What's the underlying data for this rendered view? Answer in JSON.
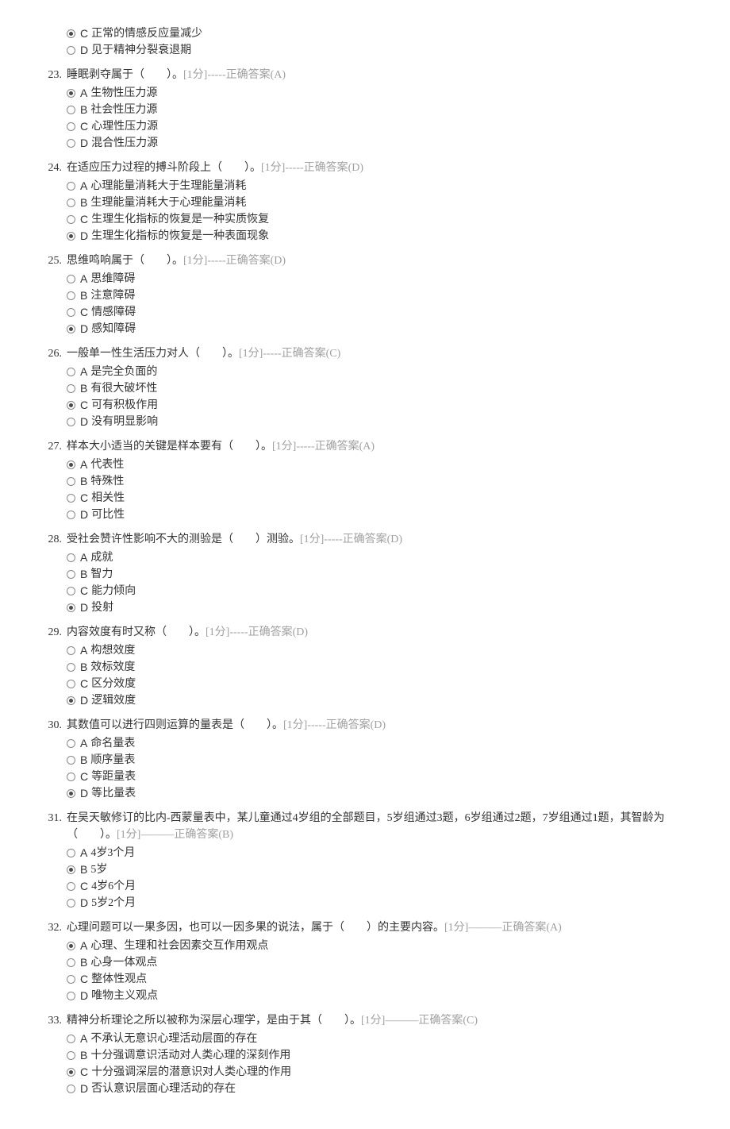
{
  "score_label": "[1分]",
  "answer_dash5_prefix": "-----正确答案",
  "answer_dash3_prefix": "———正确答案",
  "partial_options": [
    {
      "letter": "C",
      "text": " 正常的情感反应量减少",
      "selected": true
    },
    {
      "letter": "D",
      "text": " 见于精神分裂衰退期",
      "selected": false
    }
  ],
  "questions": [
    {
      "num": "23.",
      "text": "睡眠剥夺属于（　　）。",
      "dash": 5,
      "answer_letter": "(A)",
      "options": [
        {
          "letter": "A",
          "text": " 生物性压力源",
          "selected": true
        },
        {
          "letter": "B",
          "text": " 社会性压力源",
          "selected": false
        },
        {
          "letter": "C",
          "text": " 心理性压力源",
          "selected": false
        },
        {
          "letter": "D",
          "text": " 混合性压力源",
          "selected": false
        }
      ]
    },
    {
      "num": "24.",
      "text": "在适应压力过程的搏斗阶段上（　　）。",
      "dash": 5,
      "answer_letter": "(D)",
      "options": [
        {
          "letter": "A",
          "text": " 心理能量消耗大于生理能量消耗",
          "selected": false
        },
        {
          "letter": "B",
          "text": " 生理能量消耗大于心理能量消耗",
          "selected": false
        },
        {
          "letter": "C",
          "text": " 生理生化指标的恢复是一种实质恢复",
          "selected": false
        },
        {
          "letter": "D",
          "text": " 生理生化指标的恢复是一种表面现象",
          "selected": true
        }
      ]
    },
    {
      "num": "25.",
      "text": "思维鸣响属于（　　）。",
      "dash": 5,
      "answer_letter": "(D)",
      "options": [
        {
          "letter": "A",
          "text": " 思维障碍",
          "selected": false
        },
        {
          "letter": "B",
          "text": " 注意障碍",
          "selected": false
        },
        {
          "letter": "C",
          "text": " 情感障碍",
          "selected": false
        },
        {
          "letter": "D",
          "text": " 感知障碍",
          "selected": true
        }
      ]
    },
    {
      "num": "26.",
      "text": "一般单一性生活压力对人（　　）。",
      "dash": 5,
      "answer_letter": "(C)",
      "options": [
        {
          "letter": "A",
          "text": " 是完全负面的",
          "selected": false
        },
        {
          "letter": "B",
          "text": " 有很大破坏性",
          "selected": false
        },
        {
          "letter": "C",
          "text": " 可有积极作用",
          "selected": true
        },
        {
          "letter": "D",
          "text": " 没有明显影响",
          "selected": false
        }
      ]
    },
    {
      "num": "27.",
      "text": "样本大小适当的关键是样本要有（　　）。",
      "dash": 5,
      "answer_letter": "(A)",
      "options": [
        {
          "letter": "A",
          "text": " 代表性",
          "selected": true
        },
        {
          "letter": "B",
          "text": " 特殊性",
          "selected": false
        },
        {
          "letter": "C",
          "text": " 相关性",
          "selected": false
        },
        {
          "letter": "D",
          "text": " 可比性",
          "selected": false
        }
      ]
    },
    {
      "num": "28.",
      "text": "受社会赞许性影响不大的测验是（　　）测验。",
      "dash": 5,
      "answer_letter": "(D)",
      "options": [
        {
          "letter": "A",
          "text": " 成就",
          "selected": false
        },
        {
          "letter": "B",
          "text": " 智力",
          "selected": false
        },
        {
          "letter": "C",
          "text": " 能力倾向",
          "selected": false
        },
        {
          "letter": "D",
          "text": " 投射",
          "selected": true
        }
      ]
    },
    {
      "num": "29.",
      "text": "内容效度有时又称（　　）。",
      "dash": 5,
      "answer_letter": "(D)",
      "options": [
        {
          "letter": "A",
          "text": " 构想效度",
          "selected": false
        },
        {
          "letter": "B",
          "text": " 效标效度",
          "selected": false
        },
        {
          "letter": "C",
          "text": " 区分效度",
          "selected": false
        },
        {
          "letter": "D",
          "text": " 逻辑效度",
          "selected": true
        }
      ]
    },
    {
      "num": "30.",
      "text": "其数值可以进行四则运算的量表是（　　）。",
      "dash": 5,
      "answer_letter": "(D)",
      "options": [
        {
          "letter": "A",
          "text": " 命名量表",
          "selected": false
        },
        {
          "letter": "B",
          "text": " 顺序量表",
          "selected": false
        },
        {
          "letter": "C",
          "text": " 等距量表",
          "selected": false
        },
        {
          "letter": "D",
          "text": " 等比量表",
          "selected": true
        }
      ]
    },
    {
      "num": "31.",
      "text": "在吴天敏修订的比内-西蒙量表中，某儿童通过4岁组的全部题目，5岁组通过3题，6岁组通过2题，7岁组通过1题，其智龄为（　　）。",
      "dash": 3,
      "answer_letter": "(B)",
      "options": [
        {
          "letter": "A",
          "text": " 4岁3个月",
          "selected": false
        },
        {
          "letter": "B",
          "text": " 5岁",
          "selected": true
        },
        {
          "letter": "C",
          "text": " 4岁6个月",
          "selected": false
        },
        {
          "letter": "D",
          "text": " 5岁2个月",
          "selected": false
        }
      ]
    },
    {
      "num": "32.",
      "text": "心理问题可以一果多因，也可以一因多果的说法，属于（　　）的主要内容。",
      "dash": 3,
      "answer_letter": "(A)",
      "options": [
        {
          "letter": "A",
          "text": " 心理、生理和社会因素交互作用观点",
          "selected": true
        },
        {
          "letter": "B",
          "text": " 心身一体观点",
          "selected": false
        },
        {
          "letter": "C",
          "text": " 整体性观点",
          "selected": false
        },
        {
          "letter": "D",
          "text": " 唯物主义观点",
          "selected": false
        }
      ]
    },
    {
      "num": "33.",
      "text": "精神分析理论之所以被称为深层心理学，是由于其（　　）。",
      "dash": 3,
      "answer_letter": "(C)",
      "options": [
        {
          "letter": "A",
          "text": " 不承认无意识心理活动层面的存在",
          "selected": false
        },
        {
          "letter": "B",
          "text": " 十分强调意识活动对人类心理的深刻作用",
          "selected": false
        },
        {
          "letter": "C",
          "text": " 十分强调深层的潜意识对人类心理的作用",
          "selected": true
        },
        {
          "letter": "D",
          "text": " 否认意识层面心理活动的存在",
          "selected": false
        }
      ]
    }
  ]
}
